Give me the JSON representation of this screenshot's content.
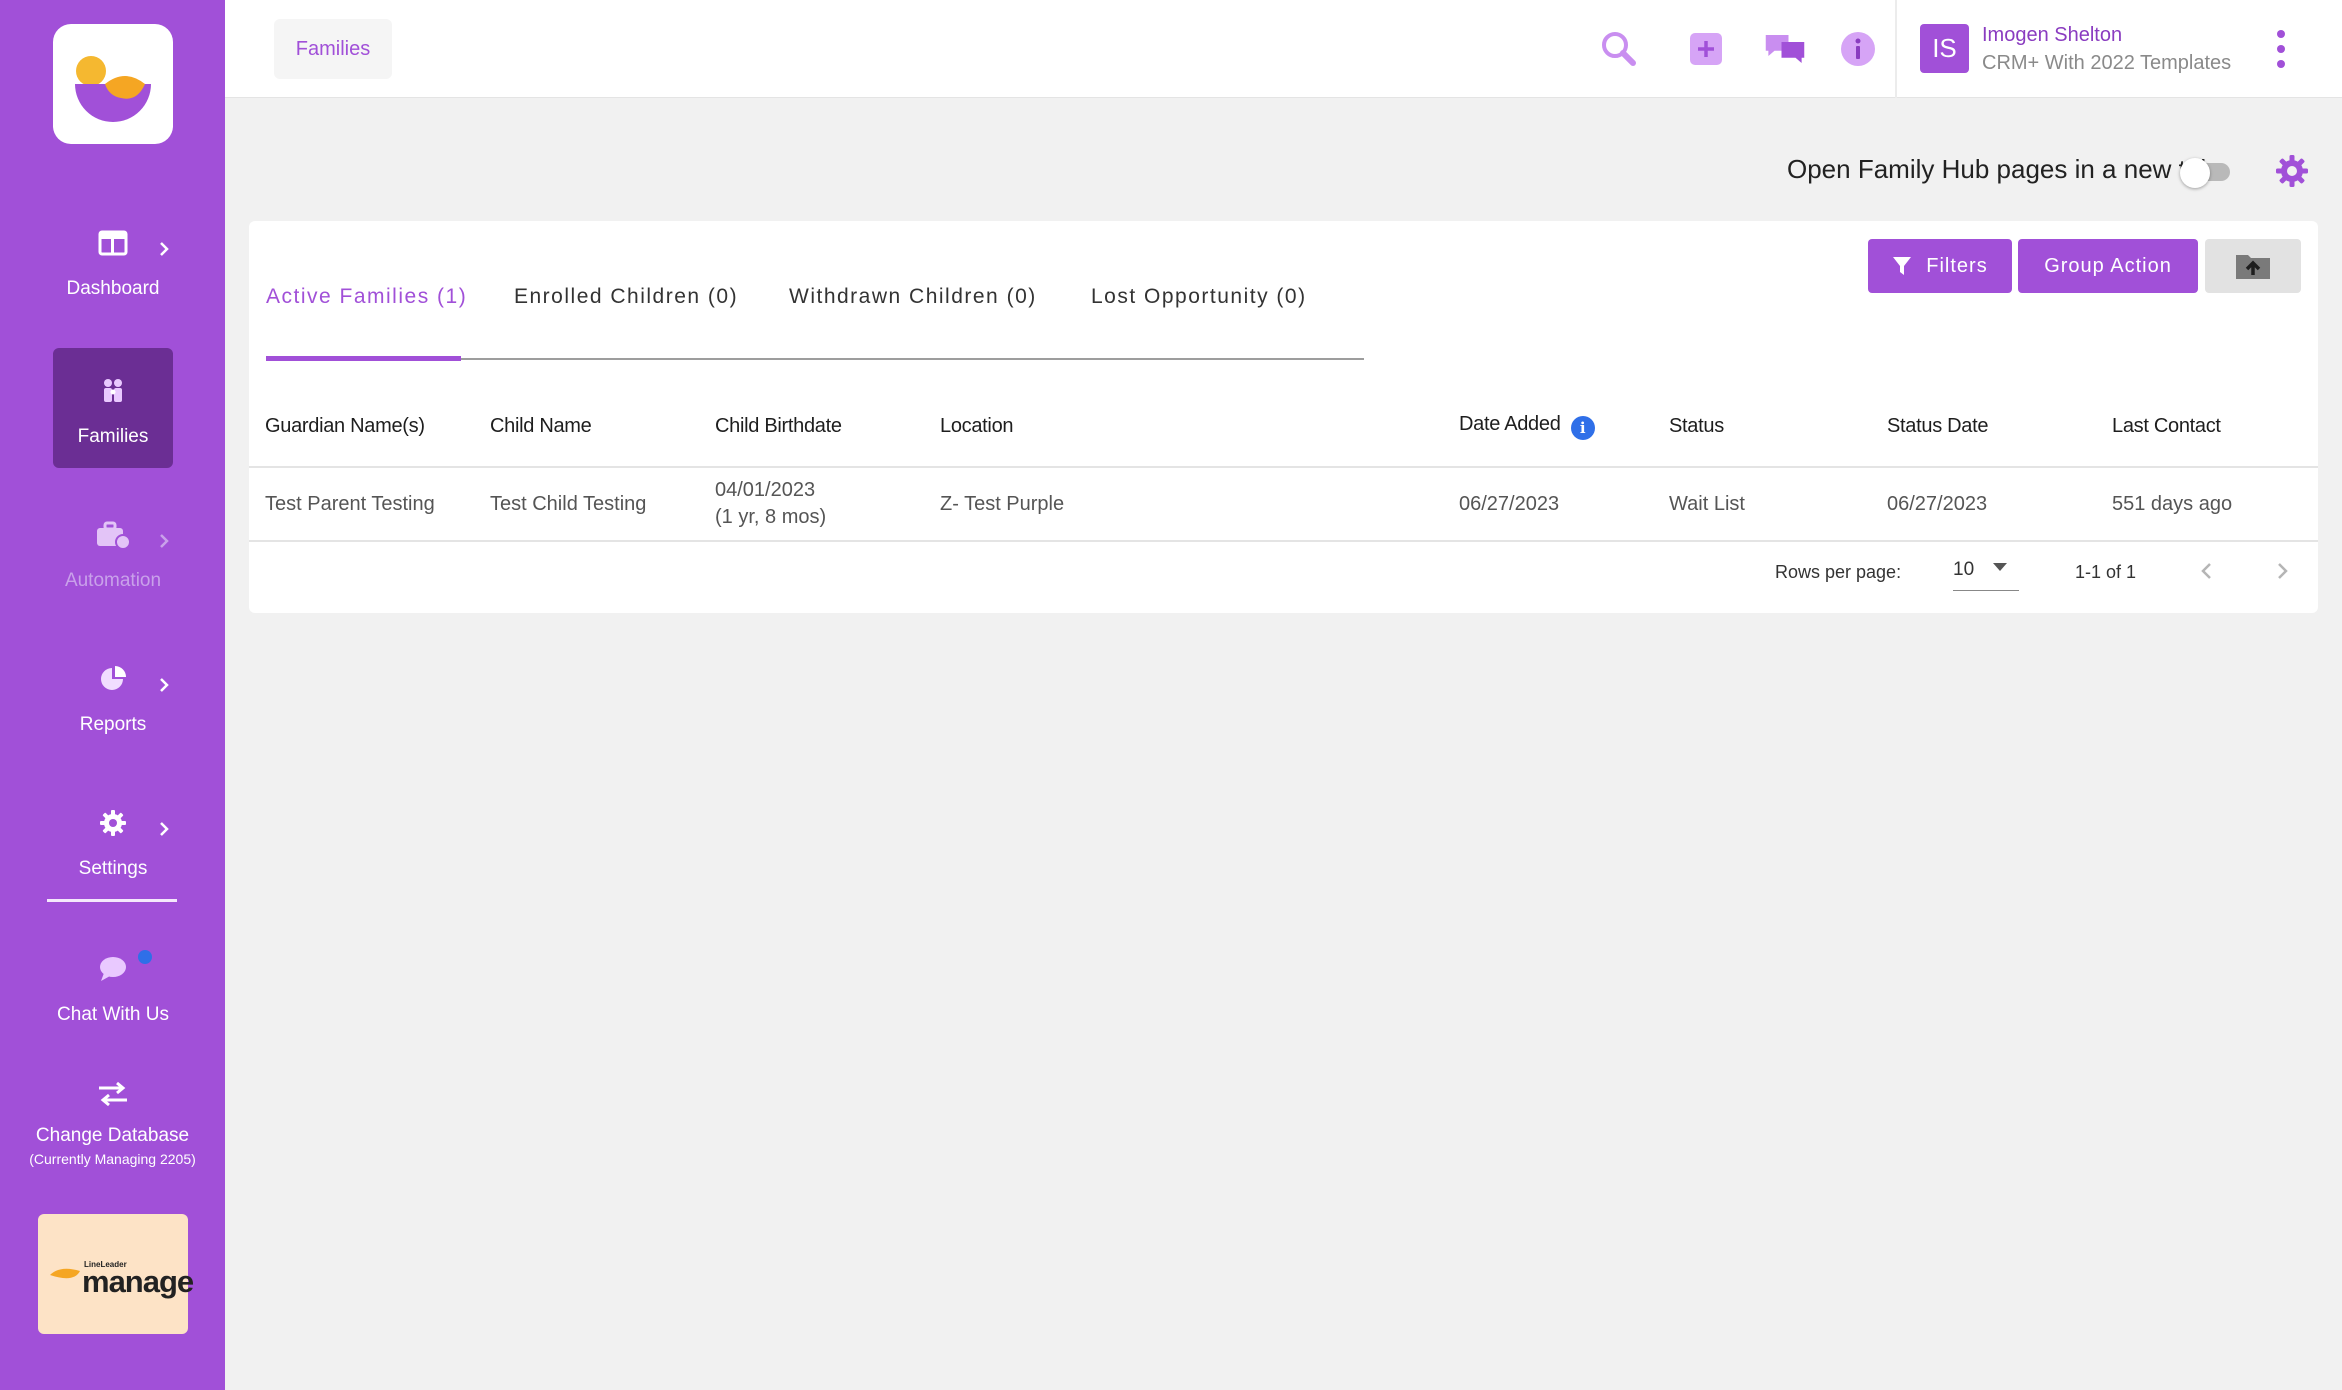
{
  "brand": {
    "logo_name": "app-logo",
    "accent": "#a150d8",
    "sidebar_active": "#6b2e94"
  },
  "sidebar": {
    "items": [
      {
        "label": "Dashboard",
        "icon": "dashboard-icon"
      },
      {
        "label": "Families",
        "icon": "families-icon",
        "active": true
      },
      {
        "label": "Automation",
        "icon": "automation-icon",
        "disabled": true
      },
      {
        "label": "Reports",
        "icon": "pie-chart-icon"
      },
      {
        "label": "Settings",
        "icon": "gear-icon"
      },
      {
        "label": "Chat With Us",
        "icon": "chat-bubble-icon"
      }
    ],
    "change_db": {
      "label": "Change Database",
      "sub": "(Currently Managing 2205)"
    },
    "manage_logo": {
      "brand": "LineLeader",
      "word": "manage"
    }
  },
  "header": {
    "breadcrumb": "Families",
    "icons": [
      "search-icon",
      "add-icon",
      "messages-icon",
      "info-icon"
    ],
    "user": {
      "initials": "IS",
      "name": "Imogen Shelton",
      "subtitle": "CRM+ With 2022 Templates"
    }
  },
  "toolbar": {
    "new_tab_label": "Open Family Hub pages in a new tab",
    "new_tab_enabled": false
  },
  "tabs": [
    {
      "label": "Active Families (1)",
      "active": true
    },
    {
      "label": "Enrolled Children (0)"
    },
    {
      "label": "Withdrawn Children (0)"
    },
    {
      "label": "Lost Opportunity (0)"
    }
  ],
  "actions": {
    "filters": "Filters",
    "group_action": "Group Action"
  },
  "table": {
    "columns": [
      "Guardian Name(s)",
      "Child Name",
      "Child Birthdate",
      "Location",
      "Date Added",
      "Status",
      "Status Date",
      "Last Contact"
    ],
    "rows": [
      {
        "guardian": "Test Parent Testing",
        "child": "Test Child Testing",
        "birthdate": "04/01/2023",
        "age": "(1 yr, 8 mos)",
        "location": "Z- Test Purple",
        "date_added": "06/27/2023",
        "status": "Wait List",
        "status_date": "06/27/2023",
        "last_contact": "551 days ago"
      }
    ]
  },
  "pagination": {
    "rows_per_page_label": "Rows per page:",
    "rows_per_page": "10",
    "range": "1-1 of 1"
  }
}
